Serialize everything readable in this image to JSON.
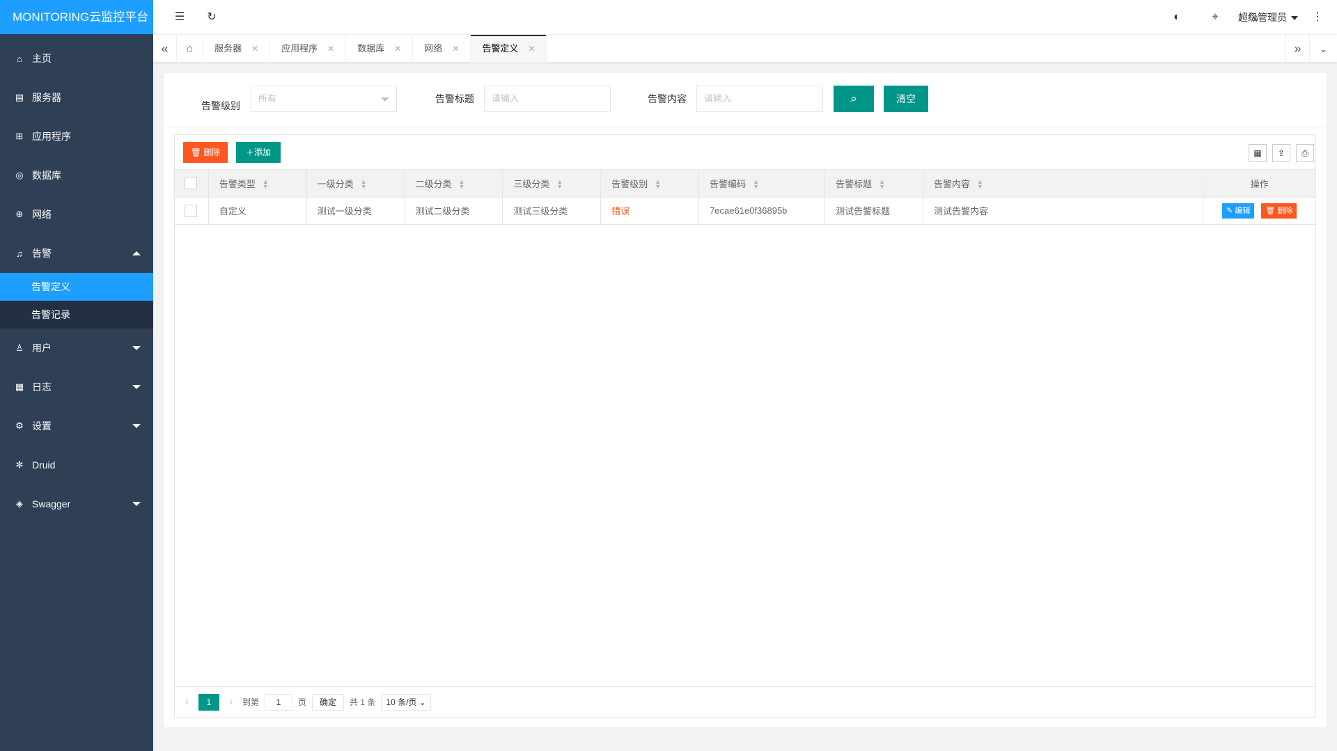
{
  "app": {
    "title": "MONITORING云监控平台"
  },
  "sidebar": {
    "items": [
      {
        "label": "主页",
        "icon": "home-icon"
      },
      {
        "label": "服务器",
        "icon": "server-icon"
      },
      {
        "label": "应用程序",
        "icon": "apps-icon"
      },
      {
        "label": "数据库",
        "icon": "database-icon"
      },
      {
        "label": "网络",
        "icon": "globe-icon"
      },
      {
        "label": "告警",
        "icon": "bell-icon"
      },
      {
        "label": "用户",
        "icon": "user-icon"
      },
      {
        "label": "日志",
        "icon": "log-icon"
      },
      {
        "label": "设置",
        "icon": "gear-icon"
      },
      {
        "label": "Druid",
        "icon": "snowflake-icon"
      },
      {
        "label": "Swagger",
        "icon": "cube-icon"
      }
    ],
    "alarm_sub": [
      "告警定义",
      "告警记录"
    ]
  },
  "topbar": {
    "user": "超级管理员"
  },
  "tabs": [
    {
      "label": "服务器"
    },
    {
      "label": "应用程序"
    },
    {
      "label": "数据库"
    },
    {
      "label": "网络"
    },
    {
      "label": "告警定义"
    }
  ],
  "filter": {
    "level_label": "告警级别",
    "level_value": "所有",
    "title_label": "告警标题",
    "title_placeholder": "请输入",
    "content_label": "告警内容",
    "content_placeholder": "请输入",
    "clear_label": "清空"
  },
  "toolbar": {
    "delete_label": "删除",
    "add_label": "添加"
  },
  "table": {
    "headers": [
      "告警类型",
      "一级分类",
      "二级分类",
      "三级分类",
      "告警级别",
      "告警编码",
      "告警标题",
      "告警内容",
      "操作"
    ],
    "rows": [
      {
        "type": "自定义",
        "cat1": "测试一级分类",
        "cat2": "测试二级分类",
        "cat3": "测试三级分类",
        "level": "错误",
        "code": "7ecae61e0f36895b",
        "title": "测试告警标题",
        "content": "测试告警内容",
        "edit": "编辑",
        "delete": "删除"
      }
    ]
  },
  "pager": {
    "current": "1",
    "goto_label": "到第",
    "page_value": "1",
    "page_unit": "页",
    "confirm": "确定",
    "total": "共 1 条",
    "size": "10 条/页"
  },
  "colors": {
    "sidebar": "#2f3f55",
    "accent": "#1e9fff",
    "primary": "#009688",
    "danger": "#ff5722"
  }
}
